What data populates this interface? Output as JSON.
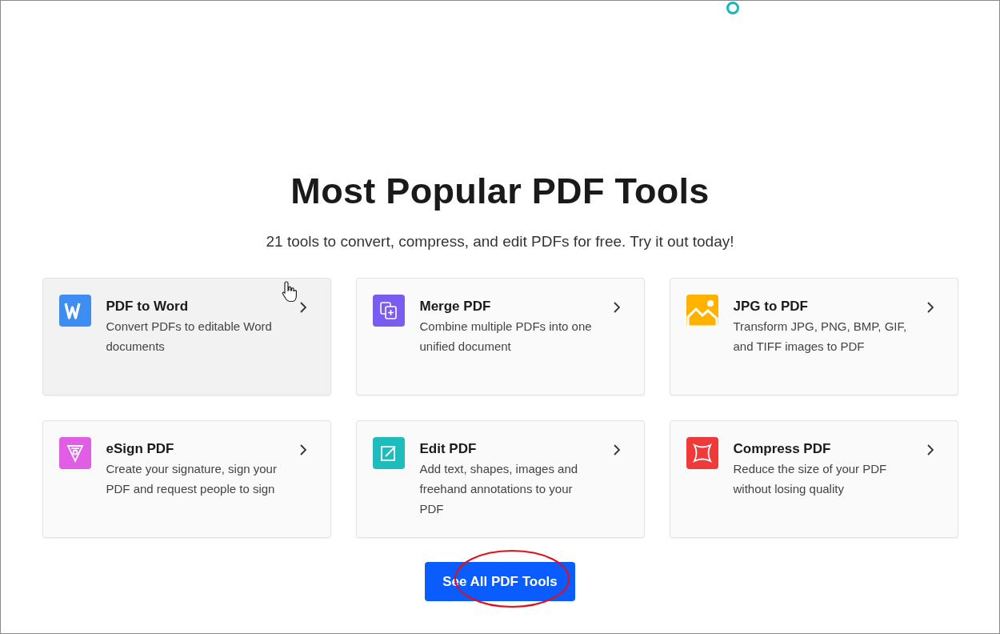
{
  "heading": "Most Popular PDF Tools",
  "subtitle": "21 tools to convert, compress, and edit PDFs for free. Try it out today!",
  "tools": [
    {
      "kind": "word",
      "color": "#3d8ef0",
      "title": "PDF to Word",
      "description": "Convert PDFs to editable Word documents",
      "highlighted": true
    },
    {
      "kind": "merge",
      "color": "#7b5cf0",
      "title": "Merge PDF",
      "description": "Combine multiple PDFs into one unified document",
      "highlighted": false
    },
    {
      "kind": "image",
      "color": "#ffb300",
      "title": "JPG to PDF",
      "description": "Transform JPG, PNG, BMP, GIF, and TIFF images to PDF",
      "highlighted": false
    },
    {
      "kind": "esign",
      "color": "#e05de6",
      "title": "eSign PDF",
      "description": "Create your signature, sign your PDF and request people to sign",
      "highlighted": false
    },
    {
      "kind": "edit",
      "color": "#1fbcbc",
      "title": "Edit PDF",
      "description": "Add text, shapes, images and freehand annotations to your PDF",
      "highlighted": false
    },
    {
      "kind": "compress",
      "color": "#f03a3a",
      "title": "Compress PDF",
      "description": "Reduce the size of your PDF without losing quality",
      "highlighted": false
    }
  ],
  "button": {
    "label": "See All PDF Tools"
  }
}
